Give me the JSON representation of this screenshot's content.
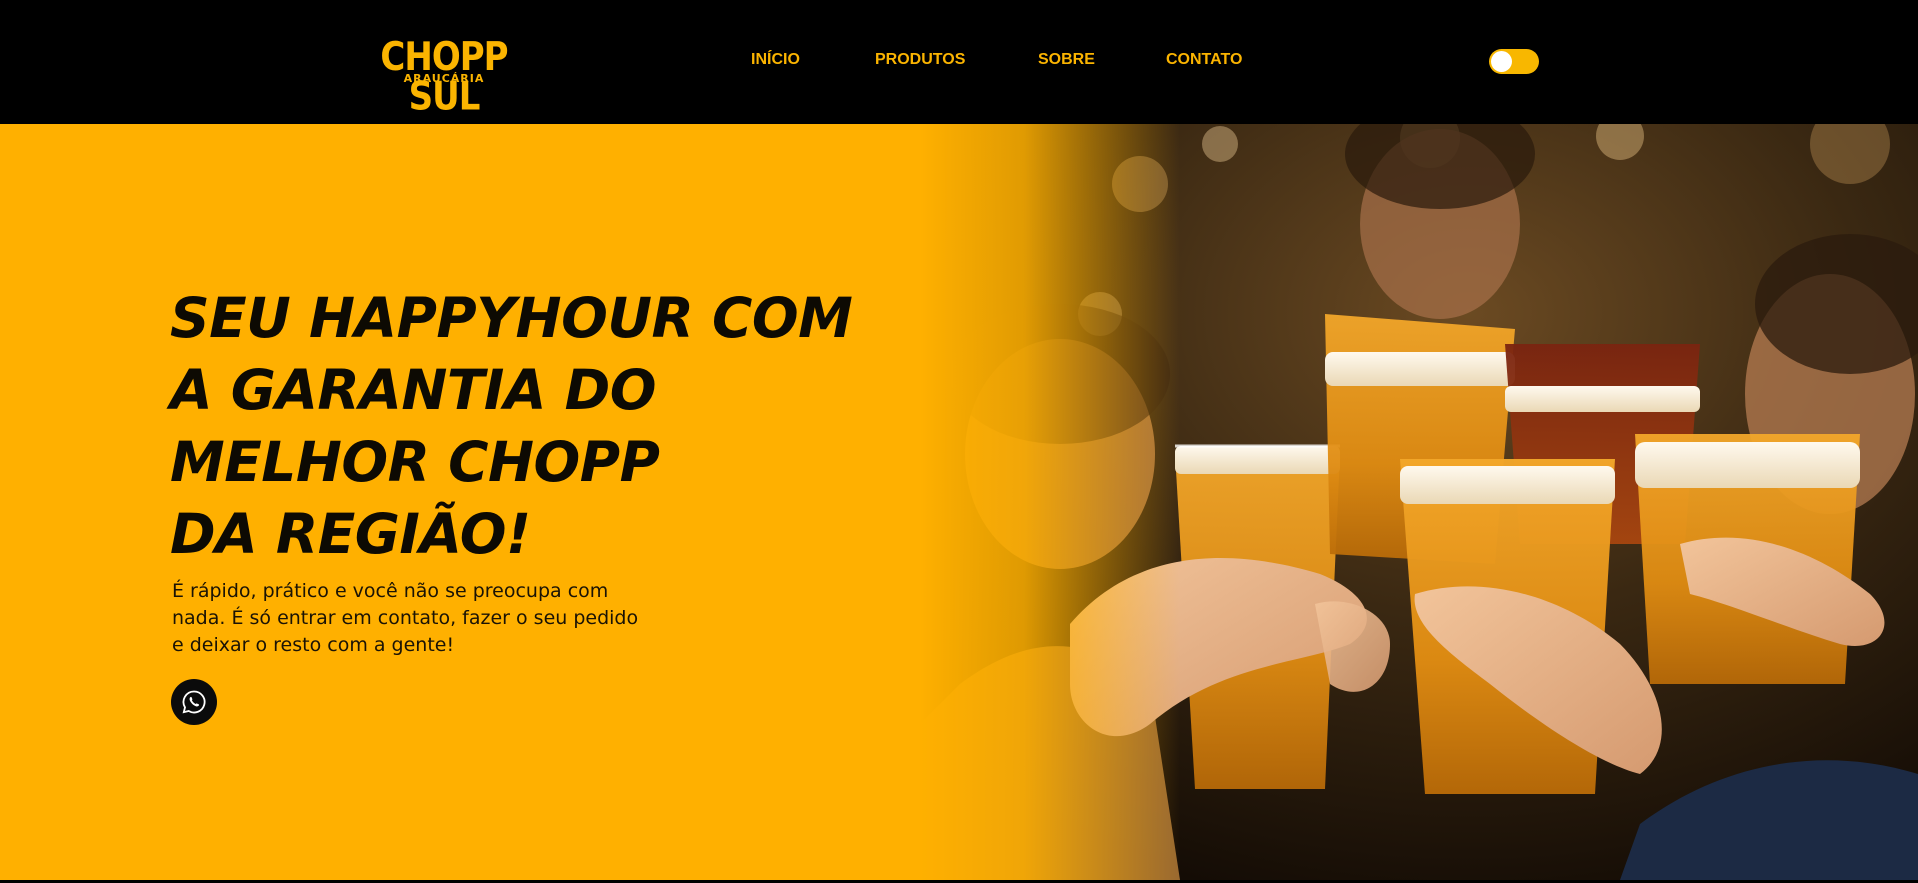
{
  "brand": {
    "name": "CHOPP SUL",
    "location": "ARAUCÁRIA",
    "accent_color": "#fbb400",
    "hero_background": "#ffb000"
  },
  "nav": {
    "items": [
      {
        "label": "INÍCIO"
      },
      {
        "label": "PRODUTOS"
      },
      {
        "label": "SOBRE"
      },
      {
        "label": "CONTATO"
      }
    ]
  },
  "theme_toggle": {
    "icon": "toggle-switch-icon",
    "state": "off"
  },
  "hero": {
    "headline_lines": [
      "SEU HAPPYHOUR COM",
      "A GARANTIA DO",
      "MELHOR CHOPP",
      "DA REGIÃO!"
    ],
    "subtitle_lines": [
      "É rápido, prático e você não se preocupa com",
      "nada. É só entrar em contato, fazer o seu pedido",
      "e deixar o resto com a gente!"
    ],
    "whatsapp_icon": "whatsapp-icon",
    "photo_icon": "beer-toast-photo"
  }
}
